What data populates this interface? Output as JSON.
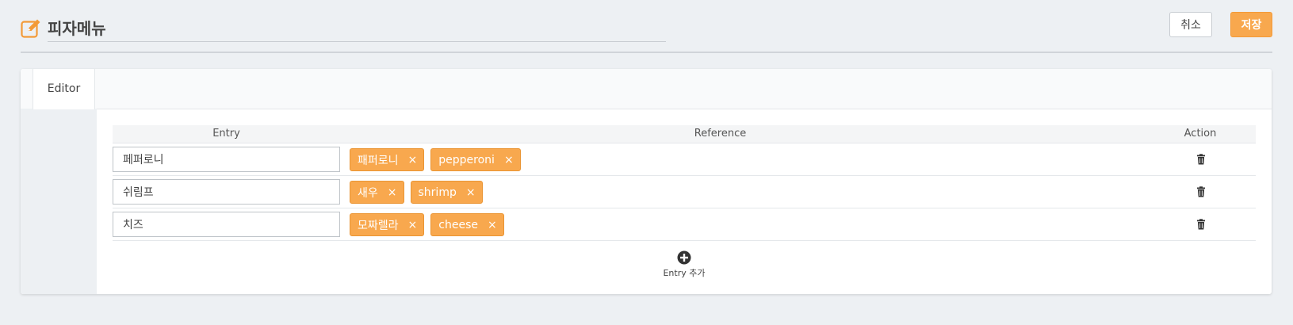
{
  "header": {
    "title": "피자메뉴",
    "cancel_label": "취소",
    "save_label": "저장",
    "icon": "edit-icon"
  },
  "tabs": [
    {
      "label": "Editor",
      "active": true
    }
  ],
  "table": {
    "columns": [
      "Entry",
      "Reference",
      "Action"
    ],
    "rows": [
      {
        "entry": "페퍼로니",
        "references": [
          "패퍼로니",
          "pepperoni"
        ]
      },
      {
        "entry": "쉬림프",
        "references": [
          "새우",
          "shrimp"
        ]
      },
      {
        "entry": "치즈",
        "references": [
          "모짜렐라",
          "cheese"
        ]
      }
    ],
    "remove_symbol": "×",
    "action_icon": "trash-icon"
  },
  "add_entry": {
    "label": "Entry 추가",
    "icon": "plus-circle-icon"
  },
  "colors": {
    "accent": "#f8a84e",
    "background": "#edf0f3"
  }
}
